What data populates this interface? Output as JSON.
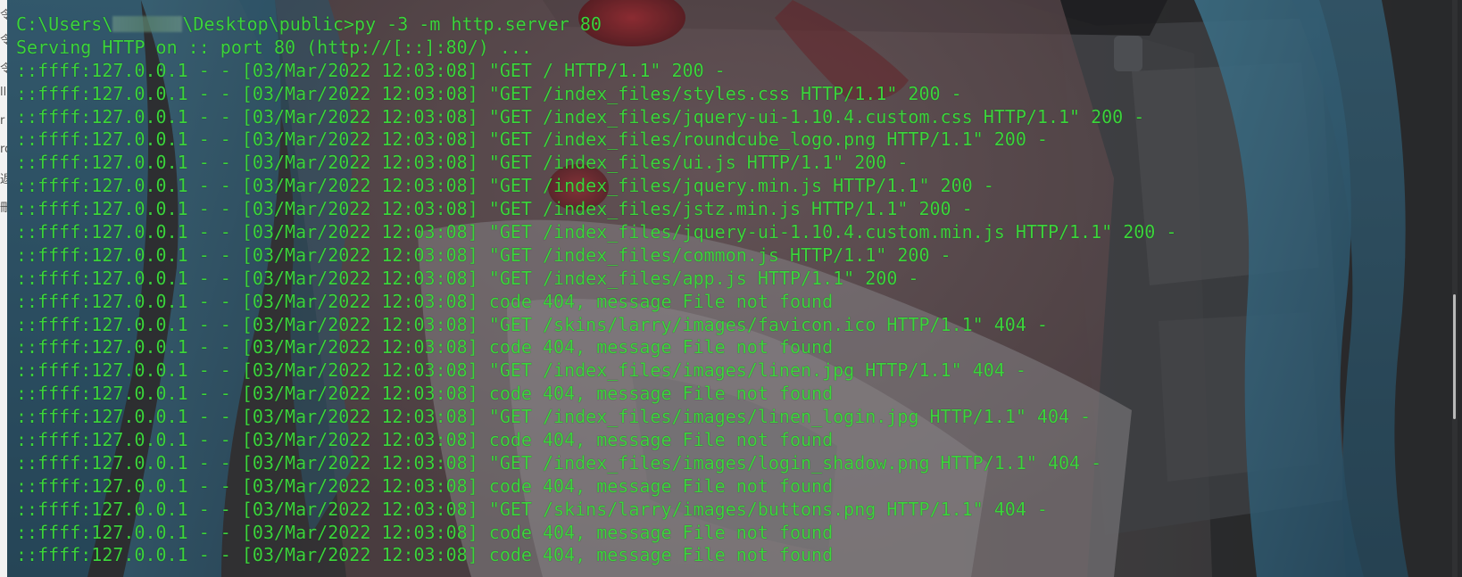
{
  "left_strip": {
    "fragments": [
      "令",
      "令",
      "令",
      "ll",
      "r",
      "ro",
      "返",
      "刪"
    ]
  },
  "terminal": {
    "prompt_prefix": "C:\\Users\\",
    "prompt_suffix": "\\Desktop\\public>py -3 -m http.server 80",
    "lines": [
      "Serving HTTP on :: port 80 (http://[::]:80/) ...",
      "::ffff:127.0.0.1 - - [03/Mar/2022 12:03:08] \"GET / HTTP/1.1\" 200 -",
      "::ffff:127.0.0.1 - - [03/Mar/2022 12:03:08] \"GET /index_files/styles.css HTTP/1.1\" 200 -",
      "::ffff:127.0.0.1 - - [03/Mar/2022 12:03:08] \"GET /index_files/jquery-ui-1.10.4.custom.css HTTP/1.1\" 200 -",
      "::ffff:127.0.0.1 - - [03/Mar/2022 12:03:08] \"GET /index_files/roundcube_logo.png HTTP/1.1\" 200 -",
      "::ffff:127.0.0.1 - - [03/Mar/2022 12:03:08] \"GET /index_files/ui.js HTTP/1.1\" 200 -",
      "::ffff:127.0.0.1 - - [03/Mar/2022 12:03:08] \"GET /index_files/jquery.min.js HTTP/1.1\" 200 -",
      "::ffff:127.0.0.1 - - [03/Mar/2022 12:03:08] \"GET /index_files/jstz.min.js HTTP/1.1\" 200 -",
      "::ffff:127.0.0.1 - - [03/Mar/2022 12:03:08] \"GET /index_files/jquery-ui-1.10.4.custom.min.js HTTP/1.1\" 200 -",
      "::ffff:127.0.0.1 - - [03/Mar/2022 12:03:08] \"GET /index_files/common.js HTTP/1.1\" 200 -",
      "::ffff:127.0.0.1 - - [03/Mar/2022 12:03:08] \"GET /index_files/app.js HTTP/1.1\" 200 -",
      "::ffff:127.0.0.1 - - [03/Mar/2022 12:03:08] code 404, message File not found",
      "::ffff:127.0.0.1 - - [03/Mar/2022 12:03:08] \"GET /skins/larry/images/favicon.ico HTTP/1.1\" 404 -",
      "::ffff:127.0.0.1 - - [03/Mar/2022 12:03:08] code 404, message File not found",
      "::ffff:127.0.0.1 - - [03/Mar/2022 12:03:08] \"GET /index_files/images/linen.jpg HTTP/1.1\" 404 -",
      "::ffff:127.0.0.1 - - [03/Mar/2022 12:03:08] code 404, message File not found",
      "::ffff:127.0.0.1 - - [03/Mar/2022 12:03:08] \"GET /index_files/images/linen_login.jpg HTTP/1.1\" 404 -",
      "::ffff:127.0.0.1 - - [03/Mar/2022 12:03:08] code 404, message File not found",
      "::ffff:127.0.0.1 - - [03/Mar/2022 12:03:08] \"GET /index_files/images/login_shadow.png HTTP/1.1\" 404 -",
      "::ffff:127.0.0.1 - - [03/Mar/2022 12:03:08] code 404, message File not found",
      "::ffff:127.0.0.1 - - [03/Mar/2022 12:03:08] \"GET /skins/larry/images/buttons.png HTTP/1.1\" 404 -",
      "::ffff:127.0.0.1 - - [03/Mar/2022 12:03:08] code 404, message File not found",
      "::ffff:127.0.0.1 - - [03/Mar/2022 12:03:08] code 404, message File not found"
    ]
  },
  "colors": {
    "text": "#3cd43c",
    "background": "#3b3b3d"
  }
}
